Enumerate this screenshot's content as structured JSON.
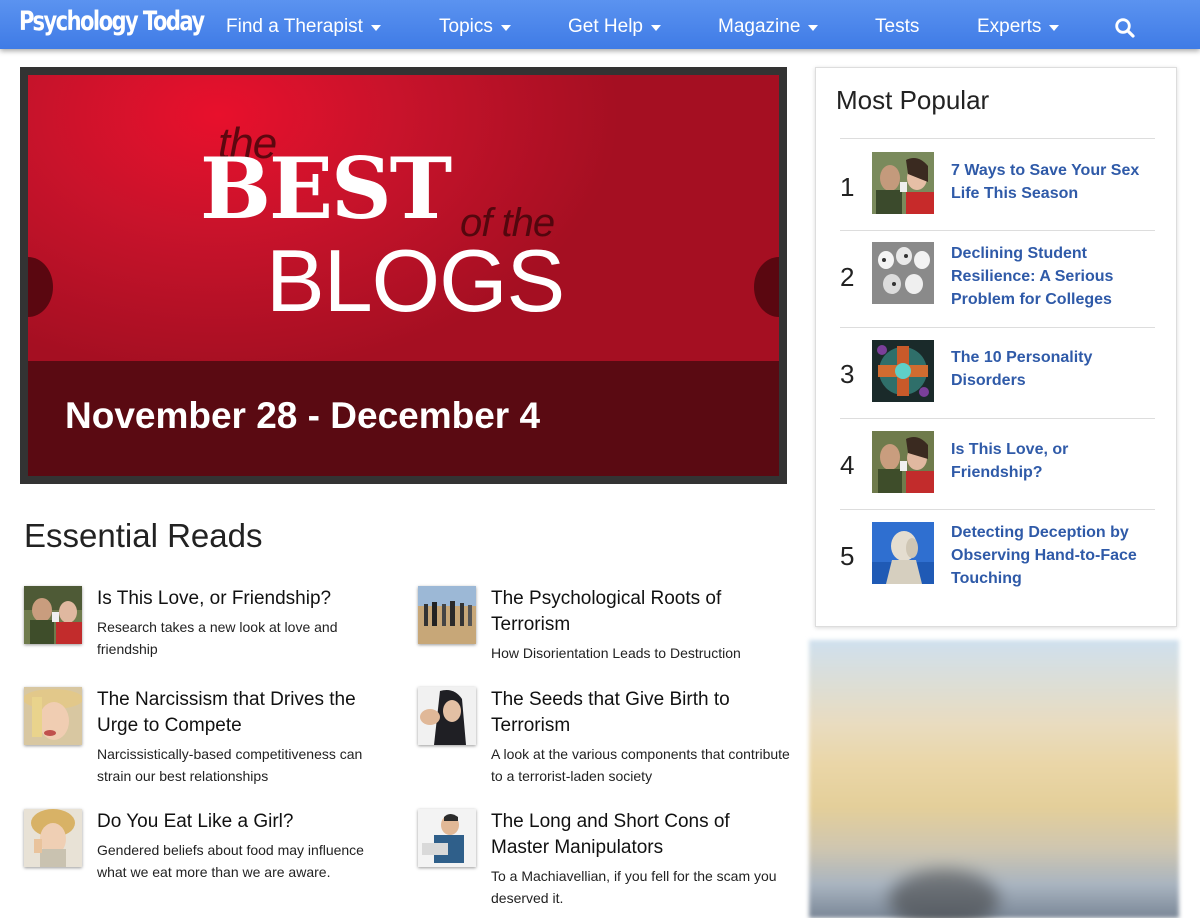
{
  "nav": {
    "logo": "Psychology Today",
    "items": [
      {
        "label": "Find a Therapist",
        "dropdown": true
      },
      {
        "label": "Topics",
        "dropdown": true
      },
      {
        "label": "Get Help",
        "dropdown": true
      },
      {
        "label": "Magazine",
        "dropdown": true
      },
      {
        "label": "Tests",
        "dropdown": false
      },
      {
        "label": "Experts",
        "dropdown": true
      }
    ],
    "search_icon": "search-icon",
    "color": "#4a85ec"
  },
  "hero": {
    "title_small": "the",
    "title_big": "BEST",
    "title_of": "of the",
    "title_blogs": "BLOGS",
    "date": "November 28 - December 4",
    "accent": "#c8132b"
  },
  "essential": {
    "title": "Essential Reads",
    "items": [
      {
        "title": "Is This Love, or Friendship?",
        "desc": "Research takes a new look at love and friendship"
      },
      {
        "title": "The Psychological Roots of Terrorism",
        "desc": "How Disorientation Leads to Destruction"
      },
      {
        "title": "The Narcissism that Drives the Urge to Compete",
        "desc": "Narcissistically-based competitiveness can strain our best relationships"
      },
      {
        "title": "The Seeds that Give Birth to Terrorism",
        "desc": "A look at the various components that contribute to a terrorist-laden society"
      },
      {
        "title": "Do You Eat Like a Girl?",
        "desc": "Gendered beliefs about food may influence what we eat more than we are aware."
      },
      {
        "title": "The Long and Short Cons of Master Manipulators",
        "desc": "To a Machiavellian, if you fell for the scam you deserved it."
      }
    ]
  },
  "popular": {
    "title": "Most Popular",
    "items": [
      {
        "rank": "1",
        "title": "7 Ways to Save Your Sex Life This Season"
      },
      {
        "rank": "2",
        "title": "Declining Student Resilience: A Serious Problem for Colleges"
      },
      {
        "rank": "3",
        "title": "The 10 Personality Disorders"
      },
      {
        "rank": "4",
        "title": "Is This Love, or Friendship?"
      },
      {
        "rank": "5",
        "title": "Detecting Deception by Observing Hand-to-Face Touching"
      }
    ],
    "link_color": "#2f5aa8"
  }
}
